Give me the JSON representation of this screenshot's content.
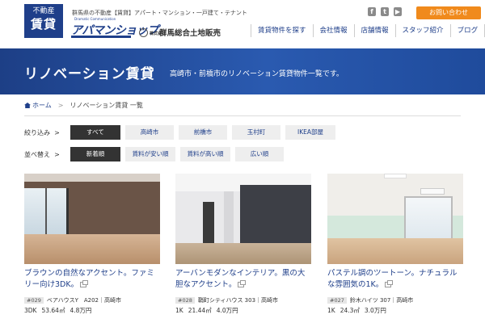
{
  "header": {
    "brand_top": "不動産",
    "brand_bottom": "賃貸",
    "tagline": "群馬県の不動産【賃貸】アパート・マンション・一戸建て・テナント",
    "logo_small": "Dramatic Communication",
    "logo_main": "アパマンショップ",
    "logo_sub_corp": "株式会社",
    "logo_sub": "群馬総合土地販売",
    "contact_label": "お問い合わせ",
    "social": [
      "f",
      "t",
      "▶"
    ],
    "nav": [
      "賃貸物件を探す",
      "会社情報",
      "店舗情報",
      "スタッフ紹介",
      "ブログ"
    ]
  },
  "hero": {
    "title": "リノベーション賃貸",
    "subtitle": "高崎市・前橋市のリノベーション賃貸物件一覧です。"
  },
  "breadcrumb": {
    "home": "ホーム",
    "separator": ">",
    "current": "リノベーション賃貸 一覧"
  },
  "filters": {
    "label": "絞り込み",
    "arrow": ">",
    "options": [
      "すべて",
      "高崎市",
      "前橋市",
      "玉村町",
      "IKEA部屋"
    ]
  },
  "sort": {
    "label": "並べ替え",
    "arrow": ">",
    "options": [
      "新着順",
      "賃料が安い順",
      "賃料が高い順",
      "広い順"
    ]
  },
  "listings": [
    {
      "title": "ブラウンの自然なアクセント。ファミリー向け3DK。",
      "id": "#029",
      "name": "ベアハウスY　A202｜高崎市",
      "layout": "3DK",
      "area": "53.64㎡",
      "rent": "4.8万円"
    },
    {
      "title": "アーバンモダンなインテリア。黒の大胆なアクセント。",
      "id": "#028",
      "name": "鞘町シティハウス 303｜高崎市",
      "layout": "1K",
      "area": "21.44㎡",
      "rent": "4.0万円"
    },
    {
      "title": "パステル調のツートーン。ナチュラルな雰囲気の1K。",
      "id": "#027",
      "name": "鈴木ハイツ 307｜高崎市",
      "layout": "1K",
      "area": "24.3㎡",
      "rent": "3.0万円"
    }
  ],
  "colors": {
    "brand_blue": "#1f3f8a",
    "accent_orange": "#f08a1c",
    "chip_active": "#333333"
  }
}
